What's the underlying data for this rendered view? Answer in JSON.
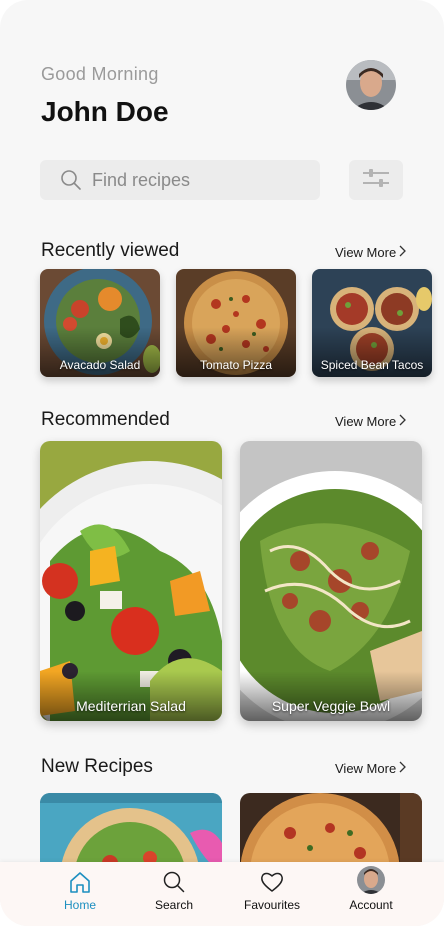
{
  "header": {
    "greeting": "Good Morning",
    "username": "John Doe"
  },
  "search": {
    "placeholder": "Find recipes"
  },
  "recently_viewed": {
    "title": "Recently viewed",
    "view_more": "View More",
    "items": [
      {
        "label": "Avacado Salad"
      },
      {
        "label": "Tomato Pizza"
      },
      {
        "label": "Spiced Bean Tacos"
      }
    ]
  },
  "recommended": {
    "title": "Recommended",
    "view_more": "View More",
    "items": [
      {
        "label": "Mediterrian Salad"
      },
      {
        "label": "Super Veggie Bowl"
      }
    ]
  },
  "new_recipes": {
    "title": "New Recipes",
    "view_more": "View More"
  },
  "nav": {
    "items": [
      {
        "label": "Home",
        "icon": "home-icon",
        "active": true
      },
      {
        "label": "Search",
        "icon": "search-icon"
      },
      {
        "label": "Favourites",
        "icon": "heart-icon"
      },
      {
        "label": "Account",
        "icon": "avatar"
      }
    ]
  },
  "colors": {
    "accent": "#1d8fc0",
    "background": "#f7f7f7",
    "search_bg": "#ececec"
  }
}
